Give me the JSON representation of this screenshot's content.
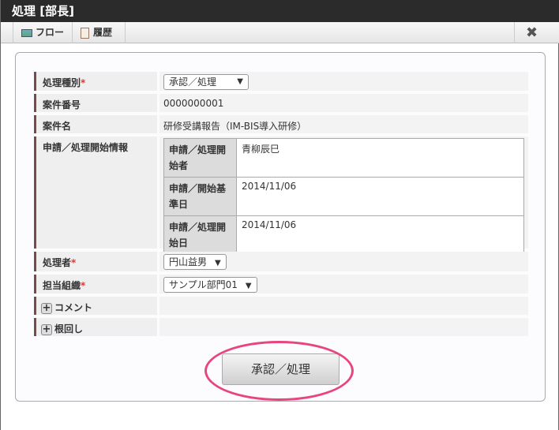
{
  "window": {
    "title": "処理 [部長]"
  },
  "toolbar": {
    "flow": "フロー",
    "history": "履歴",
    "close": "✖"
  },
  "form": {
    "process_type": {
      "label": "処理種別",
      "value": "承認／処理"
    },
    "matter_number": {
      "label": "案件番号",
      "value": "0000000001"
    },
    "matter_name": {
      "label": "案件名",
      "value": "研修受講報告（IM-BIS導入研修）"
    },
    "start_info": {
      "label": "申請／処理開始情報",
      "rows": [
        {
          "label": "申請／処理開始者",
          "value": "青柳辰巳"
        },
        {
          "label": "申請／開始基準日",
          "value": "2014/11/06"
        },
        {
          "label": "申請／処理開始日",
          "value": "2014/11/06"
        }
      ]
    },
    "processor": {
      "label": "処理者",
      "value": "円山益男"
    },
    "organization": {
      "label": "担当組織",
      "value": "サンプル部門01"
    },
    "comment": {
      "label": "コメント"
    },
    "nemawashi": {
      "label": "根回し"
    },
    "required_mark": "*"
  },
  "submit_label": "承認／処理",
  "colors": {
    "highlight": "#e8457f",
    "label_bar": "#7a4a4a"
  }
}
